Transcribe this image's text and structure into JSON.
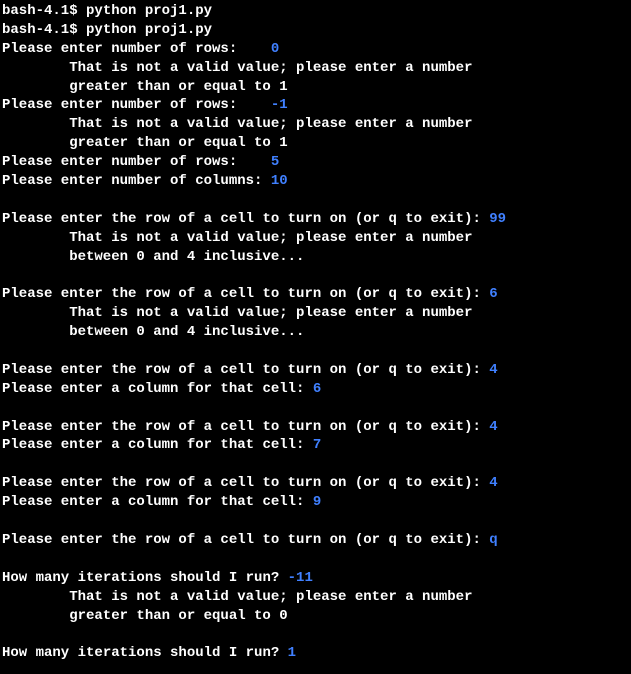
{
  "lines": [
    {
      "type": "cmd",
      "prompt": "bash-4.1$ ",
      "text": "python proj1.py"
    },
    {
      "type": "cmd",
      "prompt": "bash-4.1$ ",
      "text": "python proj1.py"
    },
    {
      "type": "prompt-input",
      "text": "Please enter number of rows:    ",
      "input": "0"
    },
    {
      "type": "indent",
      "text": "That is not a valid value; please enter a number"
    },
    {
      "type": "indent",
      "text": "greater than or equal to 1"
    },
    {
      "type": "prompt-input",
      "text": "Please enter number of rows:    ",
      "input": "-1"
    },
    {
      "type": "indent",
      "text": "That is not a valid value; please enter a number"
    },
    {
      "type": "indent",
      "text": "greater than or equal to 1"
    },
    {
      "type": "prompt-input",
      "text": "Please enter number of rows:    ",
      "input": "5"
    },
    {
      "type": "prompt-input",
      "text": "Please enter number of columns: ",
      "input": "10"
    },
    {
      "type": "blank"
    },
    {
      "type": "prompt-input",
      "text": "Please enter the row of a cell to turn on (or q to exit): ",
      "input": "99"
    },
    {
      "type": "indent",
      "text": "That is not a valid value; please enter a number"
    },
    {
      "type": "indent",
      "text": "between 0 and 4 inclusive..."
    },
    {
      "type": "blank"
    },
    {
      "type": "prompt-input",
      "text": "Please enter the row of a cell to turn on (or q to exit): ",
      "input": "6"
    },
    {
      "type": "indent",
      "text": "That is not a valid value; please enter a number"
    },
    {
      "type": "indent",
      "text": "between 0 and 4 inclusive..."
    },
    {
      "type": "blank"
    },
    {
      "type": "prompt-input",
      "text": "Please enter the row of a cell to turn on (or q to exit): ",
      "input": "4"
    },
    {
      "type": "prompt-input",
      "text": "Please enter a column for that cell: ",
      "input": "6"
    },
    {
      "type": "blank"
    },
    {
      "type": "prompt-input",
      "text": "Please enter the row of a cell to turn on (or q to exit): ",
      "input": "4"
    },
    {
      "type": "prompt-input",
      "text": "Please enter a column for that cell: ",
      "input": "7"
    },
    {
      "type": "blank"
    },
    {
      "type": "prompt-input",
      "text": "Please enter the row of a cell to turn on (or q to exit): ",
      "input": "4"
    },
    {
      "type": "prompt-input",
      "text": "Please enter a column for that cell: ",
      "input": "9"
    },
    {
      "type": "blank"
    },
    {
      "type": "prompt-input",
      "text": "Please enter the row of a cell to turn on (or q to exit): ",
      "input": "q"
    },
    {
      "type": "blank"
    },
    {
      "type": "prompt-input",
      "text": "How many iterations should I run? ",
      "input": "-11"
    },
    {
      "type": "indent",
      "text": "That is not a valid value; please enter a number"
    },
    {
      "type": "indent",
      "text": "greater than or equal to 0"
    },
    {
      "type": "blank"
    },
    {
      "type": "prompt-input",
      "text": "How many iterations should I run? ",
      "input": "1"
    }
  ]
}
